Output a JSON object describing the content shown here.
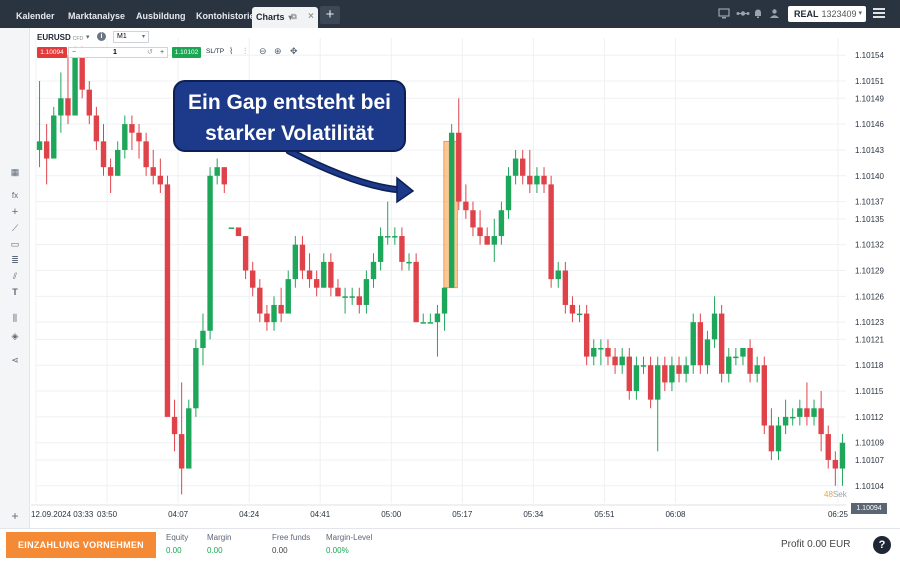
{
  "tabs": [
    {
      "label": "Kalender"
    },
    {
      "label": "Marktanalyse"
    },
    {
      "label": "Ausbildung"
    },
    {
      "label": "Kontohistorie"
    },
    {
      "label": "Charts"
    }
  ],
  "account": {
    "type": "REAL",
    "number": "1323409"
  },
  "chart_header": {
    "symbol": "EURUSD",
    "symbol_type": "CFD",
    "timeframe": "M1",
    "sell_price": "1.10094",
    "quantity": "1",
    "buy_price": "1.10102",
    "sltp_label": "SL/TP"
  },
  "annotation": {
    "line1": "Ein Gap entsteht bei",
    "line2": "starker Volatilität"
  },
  "timer": {
    "value": "48",
    "unit": "Sek"
  },
  "current_price": "1.10094",
  "bottom": {
    "deposit_label": "EINZAHLUNG VORNEHMEN",
    "equity_label": "Equity",
    "equity_value": "0.00",
    "margin_label": "Margin",
    "margin_value": "0.00",
    "free_funds_label": "Free funds",
    "free_funds_value": "0.00",
    "margin_level_label": "Margin-Level",
    "margin_level_value": "0.00%",
    "profit_text": "Profit 0.00 EUR"
  },
  "chart_data": {
    "type": "candlestick",
    "symbol": "EURUSD",
    "timeframe": "M1",
    "x_tick_labels": [
      "12.09.2024 03:33",
      "03:50",
      "04:07",
      "04:24",
      "04:41",
      "05:00",
      "05:17",
      "05:34",
      "05:51",
      "06:08",
      "06:25"
    ],
    "y_tick_labels": [
      "1.10154",
      "1.10151",
      "1.10149",
      "1.10146",
      "1.10143",
      "1.10140",
      "1.10137",
      "1.10135",
      "1.10132",
      "1.10129",
      "1.10126",
      "1.10123",
      "1.10121",
      "1.10118",
      "1.10115",
      "1.10112",
      "1.10109",
      "1.10107",
      "1.10104"
    ],
    "ylim": [
      1.10102,
      1.10156
    ],
    "colors": {
      "up": "#1ea65a",
      "down": "#e0424a",
      "gap_highlight": "#f7a95c"
    },
    "gap": {
      "from": 1.10127,
      "to": 1.10144
    },
    "candles": [
      {
        "o": 1.10143,
        "h": 1.10151,
        "l": 1.10141,
        "c": 1.10144
      },
      {
        "o": 1.10144,
        "h": 1.10146,
        "l": 1.10139,
        "c": 1.10142
      },
      {
        "o": 1.10142,
        "h": 1.10148,
        "l": 1.10142,
        "c": 1.10147
      },
      {
        "o": 1.10147,
        "h": 1.10152,
        "l": 1.10145,
        "c": 1.10149
      },
      {
        "o": 1.10149,
        "h": 1.10154,
        "l": 1.10146,
        "c": 1.10147
      },
      {
        "o": 1.10147,
        "h": 1.10155,
        "l": 1.10147,
        "c": 1.10154
      },
      {
        "o": 1.10154,
        "h": 1.10155,
        "l": 1.10149,
        "c": 1.1015
      },
      {
        "o": 1.1015,
        "h": 1.10151,
        "l": 1.10146,
        "c": 1.10147
      },
      {
        "o": 1.10147,
        "h": 1.10148,
        "l": 1.10143,
        "c": 1.10144
      },
      {
        "o": 1.10144,
        "h": 1.10146,
        "l": 1.1014,
        "c": 1.10141
      },
      {
        "o": 1.10141,
        "h": 1.10142,
        "l": 1.10138,
        "c": 1.1014
      },
      {
        "o": 1.1014,
        "h": 1.10144,
        "l": 1.1014,
        "c": 1.10143
      },
      {
        "o": 1.10143,
        "h": 1.10147,
        "l": 1.10142,
        "c": 1.10146
      },
      {
        "o": 1.10146,
        "h": 1.10147,
        "l": 1.10143,
        "c": 1.10145
      },
      {
        "o": 1.10145,
        "h": 1.10146,
        "l": 1.10142,
        "c": 1.10144
      },
      {
        "o": 1.10144,
        "h": 1.10145,
        "l": 1.1014,
        "c": 1.10141
      },
      {
        "o": 1.10141,
        "h": 1.10143,
        "l": 1.10139,
        "c": 1.1014
      },
      {
        "o": 1.1014,
        "h": 1.10142,
        "l": 1.10138,
        "c": 1.10139
      },
      {
        "o": 1.10139,
        "h": 1.1014,
        "l": 1.10113,
        "c": 1.10112
      },
      {
        "o": 1.10112,
        "h": 1.10114,
        "l": 1.10108,
        "c": 1.1011
      },
      {
        "o": 1.1011,
        "h": 1.10116,
        "l": 1.10103,
        "c": 1.10106
      },
      {
        "o": 1.10106,
        "h": 1.10114,
        "l": 1.10106,
        "c": 1.10113
      },
      {
        "o": 1.10113,
        "h": 1.10121,
        "l": 1.10112,
        "c": 1.1012
      },
      {
        "o": 1.1012,
        "h": 1.10124,
        "l": 1.10118,
        "c": 1.10122
      },
      {
        "o": 1.10122,
        "h": 1.10141,
        "l": 1.10121,
        "c": 1.1014
      },
      {
        "o": 1.1014,
        "h": 1.10142,
        "l": 1.10139,
        "c": 1.10141
      },
      {
        "o": 1.10141,
        "h": 1.10141,
        "l": 1.10138,
        "c": 1.10139
      },
      {
        "o": 1.10134,
        "h": 1.10134,
        "l": 1.10134,
        "c": 1.10134
      },
      {
        "o": 1.10134,
        "h": 1.10134,
        "l": 1.10133,
        "c": 1.10133
      },
      {
        "o": 1.10133,
        "h": 1.10133,
        "l": 1.10128,
        "c": 1.10129
      },
      {
        "o": 1.10129,
        "h": 1.1013,
        "l": 1.10126,
        "c": 1.10127
      },
      {
        "o": 1.10127,
        "h": 1.10128,
        "l": 1.10123,
        "c": 1.10124
      },
      {
        "o": 1.10124,
        "h": 1.10125,
        "l": 1.10122,
        "c": 1.10123
      },
      {
        "o": 1.10123,
        "h": 1.10126,
        "l": 1.10122,
        "c": 1.10125
      },
      {
        "o": 1.10125,
        "h": 1.10127,
        "l": 1.10123,
        "c": 1.10124
      },
      {
        "o": 1.10124,
        "h": 1.10129,
        "l": 1.10124,
        "c": 1.10128
      },
      {
        "o": 1.10128,
        "h": 1.10133,
        "l": 1.10127,
        "c": 1.10132
      },
      {
        "o": 1.10132,
        "h": 1.10133,
        "l": 1.10128,
        "c": 1.10129
      },
      {
        "o": 1.10129,
        "h": 1.10131,
        "l": 1.10127,
        "c": 1.10128
      },
      {
        "o": 1.10128,
        "h": 1.10129,
        "l": 1.10126,
        "c": 1.10127
      },
      {
        "o": 1.10127,
        "h": 1.10131,
        "l": 1.10127,
        "c": 1.1013
      },
      {
        "o": 1.1013,
        "h": 1.10131,
        "l": 1.10126,
        "c": 1.10127
      },
      {
        "o": 1.10127,
        "h": 1.10128,
        "l": 1.10126,
        "c": 1.10126
      },
      {
        "o": 1.10126,
        "h": 1.10127,
        "l": 1.10124,
        "c": 1.10126
      },
      {
        "o": 1.10126,
        "h": 1.10127,
        "l": 1.10125,
        "c": 1.10126
      },
      {
        "o": 1.10126,
        "h": 1.10127,
        "l": 1.10124,
        "c": 1.10125
      },
      {
        "o": 1.10125,
        "h": 1.10129,
        "l": 1.10124,
        "c": 1.10128
      },
      {
        "o": 1.10128,
        "h": 1.10131,
        "l": 1.10127,
        "c": 1.1013
      },
      {
        "o": 1.1013,
        "h": 1.10134,
        "l": 1.10129,
        "c": 1.10133
      },
      {
        "o": 1.10133,
        "h": 1.10137,
        "l": 1.10132,
        "c": 1.10133
      },
      {
        "o": 1.10133,
        "h": 1.10134,
        "l": 1.10132,
        "c": 1.10133
      },
      {
        "o": 1.10133,
        "h": 1.10134,
        "l": 1.10129,
        "c": 1.1013
      },
      {
        "o": 1.1013,
        "h": 1.10131,
        "l": 1.10129,
        "c": 1.1013
      },
      {
        "o": 1.1013,
        "h": 1.10131,
        "l": 1.10123,
        "c": 1.10123
      },
      {
        "o": 1.10123,
        "h": 1.10124,
        "l": 1.10123,
        "c": 1.10123
      },
      {
        "o": 1.10123,
        "h": 1.10124,
        "l": 1.10123,
        "c": 1.10123
      },
      {
        "o": 1.10123,
        "h": 1.10125,
        "l": 1.10119,
        "c": 1.10124
      },
      {
        "o": 1.10124,
        "h": 1.10127,
        "l": 1.10122,
        "c": 1.10127
      },
      {
        "o": 1.10127,
        "h": 1.10146,
        "l": 1.10127,
        "c": 1.10145
      },
      {
        "o": 1.10145,
        "h": 1.10149,
        "l": 1.10136,
        "c": 1.10137
      },
      {
        "o": 1.10137,
        "h": 1.10139,
        "l": 1.10135,
        "c": 1.10136
      },
      {
        "o": 1.10136,
        "h": 1.10137,
        "l": 1.10133,
        "c": 1.10134
      },
      {
        "o": 1.10134,
        "h": 1.10136,
        "l": 1.10132,
        "c": 1.10133
      },
      {
        "o": 1.10133,
        "h": 1.10134,
        "l": 1.10132,
        "c": 1.10132
      },
      {
        "o": 1.10132,
        "h": 1.10135,
        "l": 1.1013,
        "c": 1.10133
      },
      {
        "o": 1.10133,
        "h": 1.10137,
        "l": 1.10132,
        "c": 1.10136
      },
      {
        "o": 1.10136,
        "h": 1.10141,
        "l": 1.10135,
        "c": 1.1014
      },
      {
        "o": 1.1014,
        "h": 1.10143,
        "l": 1.10139,
        "c": 1.10142
      },
      {
        "o": 1.10142,
        "h": 1.10143,
        "l": 1.10139,
        "c": 1.1014
      },
      {
        "o": 1.1014,
        "h": 1.10143,
        "l": 1.10138,
        "c": 1.10139
      },
      {
        "o": 1.10139,
        "h": 1.10141,
        "l": 1.10138,
        "c": 1.1014
      },
      {
        "o": 1.1014,
        "h": 1.10141,
        "l": 1.10138,
        "c": 1.10139
      },
      {
        "o": 1.10139,
        "h": 1.1014,
        "l": 1.10127,
        "c": 1.10128
      },
      {
        "o": 1.10128,
        "h": 1.1013,
        "l": 1.10127,
        "c": 1.10129
      },
      {
        "o": 1.10129,
        "h": 1.1013,
        "l": 1.10124,
        "c": 1.10125
      },
      {
        "o": 1.10125,
        "h": 1.10126,
        "l": 1.10123,
        "c": 1.10124
      },
      {
        "o": 1.10124,
        "h": 1.10125,
        "l": 1.10123,
        "c": 1.10124
      },
      {
        "o": 1.10124,
        "h": 1.10125,
        "l": 1.10118,
        "c": 1.10119
      },
      {
        "o": 1.10119,
        "h": 1.10121,
        "l": 1.10118,
        "c": 1.1012
      },
      {
        "o": 1.1012,
        "h": 1.10121,
        "l": 1.10118,
        "c": 1.1012
      },
      {
        "o": 1.1012,
        "h": 1.10121,
        "l": 1.10118,
        "c": 1.10119
      },
      {
        "o": 1.10119,
        "h": 1.1012,
        "l": 1.10117,
        "c": 1.10118
      },
      {
        "o": 1.10118,
        "h": 1.1012,
        "l": 1.10117,
        "c": 1.10119
      },
      {
        "o": 1.10119,
        "h": 1.1012,
        "l": 1.10114,
        "c": 1.10115
      },
      {
        "o": 1.10115,
        "h": 1.10119,
        "l": 1.10114,
        "c": 1.10118
      },
      {
        "o": 1.10118,
        "h": 1.10119,
        "l": 1.10117,
        "c": 1.10118
      },
      {
        "o": 1.10118,
        "h": 1.10119,
        "l": 1.10113,
        "c": 1.10114
      },
      {
        "o": 1.10114,
        "h": 1.10119,
        "l": 1.10108,
        "c": 1.10118
      },
      {
        "o": 1.10118,
        "h": 1.10119,
        "l": 1.10115,
        "c": 1.10116
      },
      {
        "o": 1.10116,
        "h": 1.10119,
        "l": 1.10115,
        "c": 1.10118
      },
      {
        "o": 1.10118,
        "h": 1.10119,
        "l": 1.10116,
        "c": 1.10117
      },
      {
        "o": 1.10117,
        "h": 1.10119,
        "l": 1.10116,
        "c": 1.10118
      },
      {
        "o": 1.10118,
        "h": 1.10124,
        "l": 1.10117,
        "c": 1.10123
      },
      {
        "o": 1.10123,
        "h": 1.10124,
        "l": 1.10117,
        "c": 1.10118
      },
      {
        "o": 1.10118,
        "h": 1.10122,
        "l": 1.10117,
        "c": 1.10121
      },
      {
        "o": 1.10121,
        "h": 1.10126,
        "l": 1.1012,
        "c": 1.10124
      },
      {
        "o": 1.10124,
        "h": 1.10125,
        "l": 1.10116,
        "c": 1.10117
      },
      {
        "o": 1.10117,
        "h": 1.1012,
        "l": 1.10116,
        "c": 1.10119
      },
      {
        "o": 1.10119,
        "h": 1.1012,
        "l": 1.10118,
        "c": 1.10119
      },
      {
        "o": 1.10119,
        "h": 1.1012,
        "l": 1.10118,
        "c": 1.1012
      },
      {
        "o": 1.1012,
        "h": 1.10121,
        "l": 1.10116,
        "c": 1.10117
      },
      {
        "o": 1.10117,
        "h": 1.10119,
        "l": 1.10116,
        "c": 1.10118
      },
      {
        "o": 1.10118,
        "h": 1.10119,
        "l": 1.1011,
        "c": 1.10111
      },
      {
        "o": 1.10111,
        "h": 1.10113,
        "l": 1.10107,
        "c": 1.10108
      },
      {
        "o": 1.10108,
        "h": 1.10112,
        "l": 1.10107,
        "c": 1.10111
      },
      {
        "o": 1.10111,
        "h": 1.10114,
        "l": 1.1011,
        "c": 1.10112
      },
      {
        "o": 1.10112,
        "h": 1.10113,
        "l": 1.10111,
        "c": 1.10112
      },
      {
        "o": 1.10112,
        "h": 1.10114,
        "l": 1.10111,
        "c": 1.10113
      },
      {
        "o": 1.10113,
        "h": 1.10116,
        "l": 1.10111,
        "c": 1.10112
      },
      {
        "o": 1.10112,
        "h": 1.10114,
        "l": 1.10111,
        "c": 1.10113
      },
      {
        "o": 1.10113,
        "h": 1.10115,
        "l": 1.10108,
        "c": 1.1011
      },
      {
        "o": 1.1011,
        "h": 1.10111,
        "l": 1.10106,
        "c": 1.10107
      },
      {
        "o": 1.10107,
        "h": 1.10108,
        "l": 1.10104,
        "c": 1.10106
      },
      {
        "o": 1.10106,
        "h": 1.1011,
        "l": 1.10104,
        "c": 1.10109
      }
    ]
  }
}
